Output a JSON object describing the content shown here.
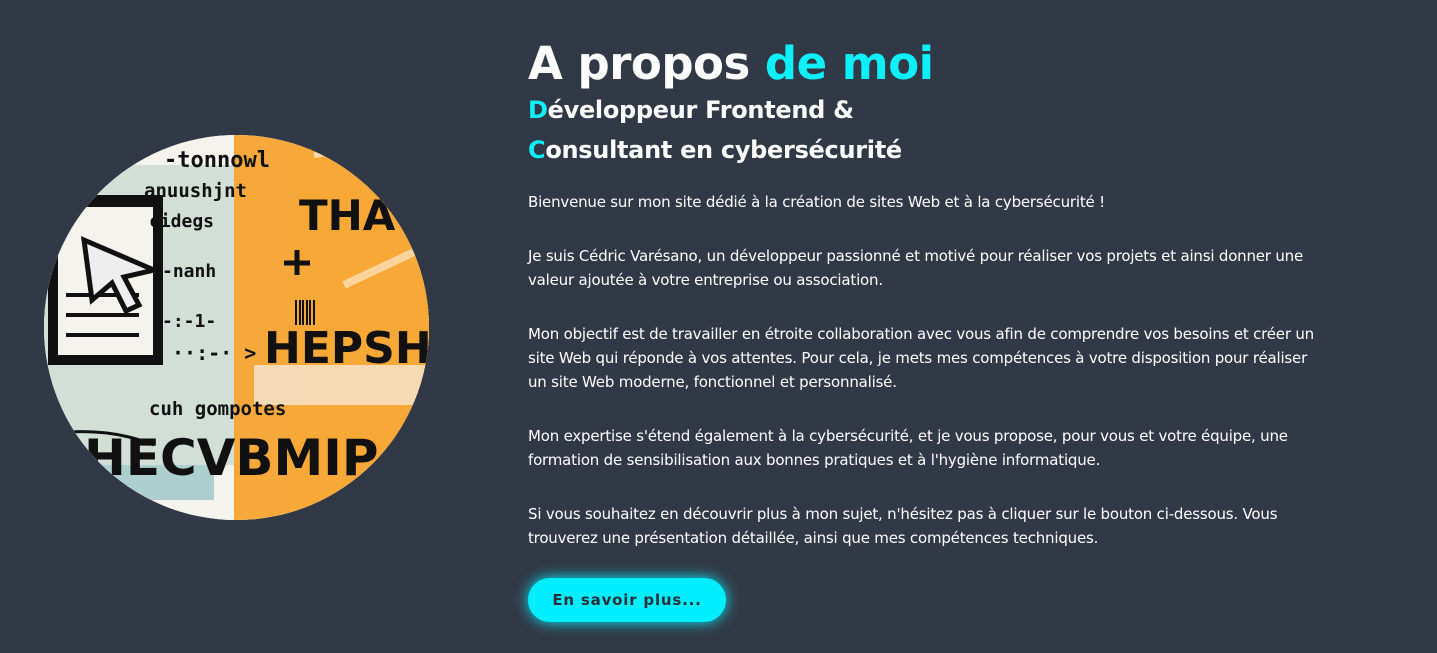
{
  "about": {
    "heading_main": "A propos",
    "heading_accent": "de moi",
    "subtitle": {
      "line1_initial": "D",
      "line1_rest": "éveloppeur Frontend &",
      "line2_initial": "C",
      "line2_rest": "onsultant en cybersécurité"
    },
    "paragraphs": [
      "Bienvenue sur mon site dédié à la création de sites Web et à la cybersécurité !",
      "Je suis Cédric Varésano, un développeur passionné et motivé pour réaliser vos projets et ainsi donner une valeur ajoutée à votre entreprise ou association.",
      "Mon objectif est de travailler en étroite collaboration avec vous afin de comprendre vos besoins et créer un site Web qui réponde à vos attentes. Pour cela, je mets mes compétences à votre disposition pour réaliser un site Web moderne, fonctionnel et personnalisé.",
      "Mon expertise s'étend également à la cybersécurité, et je vous propose, pour vous et votre équipe, une formation de sensibilisation aux bonnes pratiques et à l'hygiène informatique.",
      "Si vous souhaitez en découvrir plus à mon sujet, n'hésitez pas à cliquer sur le bouton ci-dessous. Vous trouverez une présentation détaillée, ainsi que mes compétences techniques."
    ],
    "button_label": "En savoir plus...",
    "illustration_text": {
      "line1": "-tonnowl",
      "line2": "anuushjnt",
      "line3": "cidegs",
      "line4": "-nanh",
      "line5": "-:-1-",
      "line6": "··:-· >",
      "line7": "cuh gompotes",
      "big1": "THAT",
      "big2": "HEPSHI",
      "big3": "HECVBMIP"
    }
  },
  "colors": {
    "background": "#323946",
    "accent": "#0ef0f9",
    "text": "#ffffff",
    "button_bg": "#00eeff",
    "button_text": "#2b2f3a"
  }
}
